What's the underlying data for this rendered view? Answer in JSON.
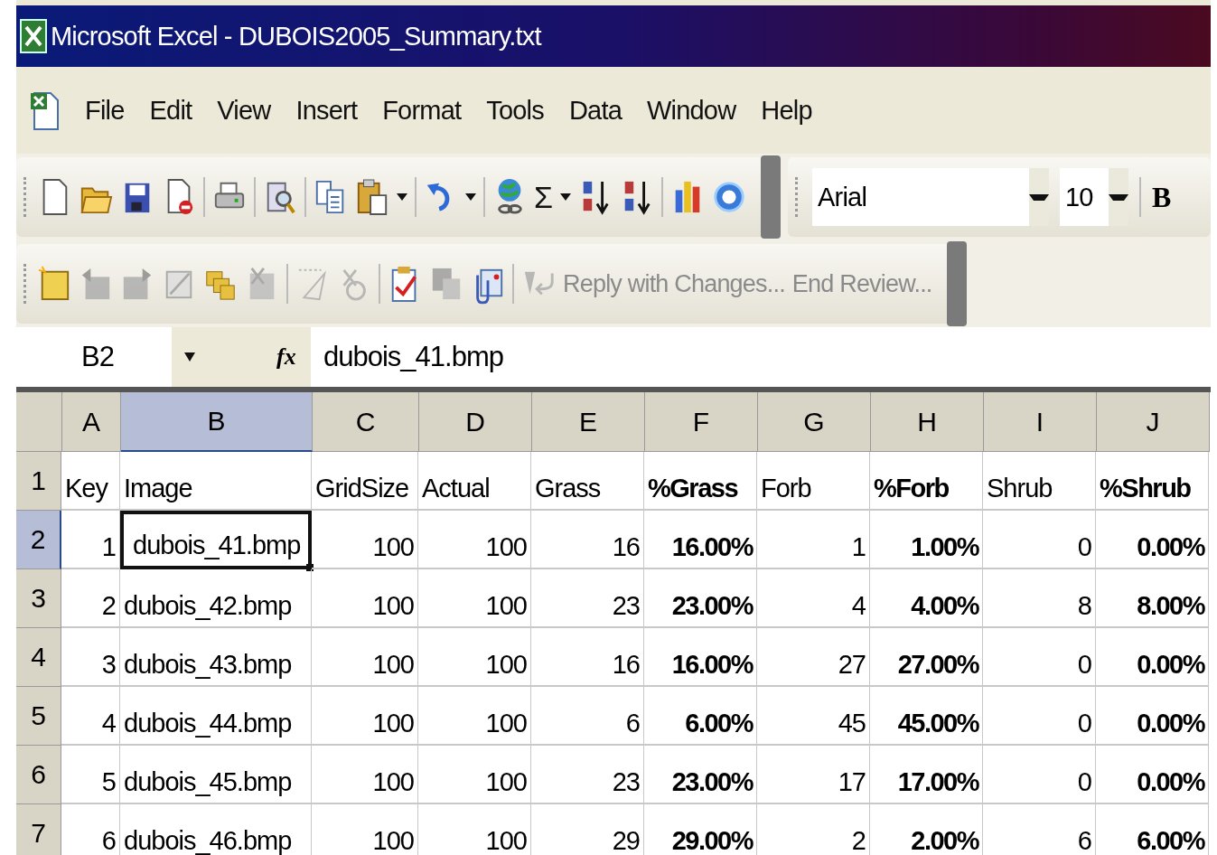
{
  "window": {
    "title": "Microsoft Excel - DUBOIS2005_Summary.txt"
  },
  "menu": [
    "File",
    "Edit",
    "View",
    "Insert",
    "Format",
    "Tools",
    "Data",
    "Window",
    "Help"
  ],
  "standard_toolbar": {
    "sum_symbol": "Σ"
  },
  "formatting_toolbar": {
    "font": "Arial",
    "size": "10",
    "bold_button": "B"
  },
  "reviewing_toolbar": {
    "reply": "Reply with Changes...",
    "end_review": "End Review..."
  },
  "formula_bar": {
    "name_box": "B2",
    "fx": "fx",
    "formula": "dubois_41.bmp"
  },
  "columns": [
    {
      "letter": "A",
      "selected": false,
      "bold": false
    },
    {
      "letter": "B",
      "selected": true,
      "bold": false
    },
    {
      "letter": "C",
      "selected": false,
      "bold": false
    },
    {
      "letter": "D",
      "selected": false,
      "bold": false
    },
    {
      "letter": "E",
      "selected": false,
      "bold": false
    },
    {
      "letter": "F",
      "selected": false,
      "bold": true
    },
    {
      "letter": "G",
      "selected": false,
      "bold": false
    },
    {
      "letter": "H",
      "selected": false,
      "bold": true
    },
    {
      "letter": "I",
      "selected": false,
      "bold": false
    },
    {
      "letter": "J",
      "selected": false,
      "bold": true
    }
  ],
  "rows": [
    {
      "number": "1",
      "selected": false,
      "kind": "header",
      "cells": [
        "Key",
        "Image",
        "GridSize",
        "Actual",
        "Grass",
        "%Grass",
        "Forb",
        "%Forb",
        "Shrub",
        "%Shrub"
      ]
    },
    {
      "number": "2",
      "selected": true,
      "kind": "data",
      "cells": [
        "1",
        "dubois_41.bmp",
        "100",
        "100",
        "16",
        "16.00%",
        "1",
        "1.00%",
        "0",
        "0.00%"
      ]
    },
    {
      "number": "3",
      "selected": false,
      "kind": "data",
      "cells": [
        "2",
        "dubois_42.bmp",
        "100",
        "100",
        "23",
        "23.00%",
        "4",
        "4.00%",
        "8",
        "8.00%"
      ]
    },
    {
      "number": "4",
      "selected": false,
      "kind": "data",
      "cells": [
        "3",
        "dubois_43.bmp",
        "100",
        "100",
        "16",
        "16.00%",
        "27",
        "27.00%",
        "0",
        "0.00%"
      ]
    },
    {
      "number": "5",
      "selected": false,
      "kind": "data",
      "cells": [
        "4",
        "dubois_44.bmp",
        "100",
        "100",
        "6",
        "6.00%",
        "45",
        "45.00%",
        "0",
        "0.00%"
      ]
    },
    {
      "number": "6",
      "selected": false,
      "kind": "data",
      "cells": [
        "5",
        "dubois_45.bmp",
        "100",
        "100",
        "23",
        "23.00%",
        "17",
        "17.00%",
        "0",
        "0.00%"
      ]
    },
    {
      "number": "7",
      "selected": false,
      "kind": "data",
      "cells": [
        "6",
        "dubois_46.bmp",
        "100",
        "100",
        "29",
        "29.00%",
        "2",
        "2.00%",
        "6",
        "6.00%"
      ]
    }
  ]
}
